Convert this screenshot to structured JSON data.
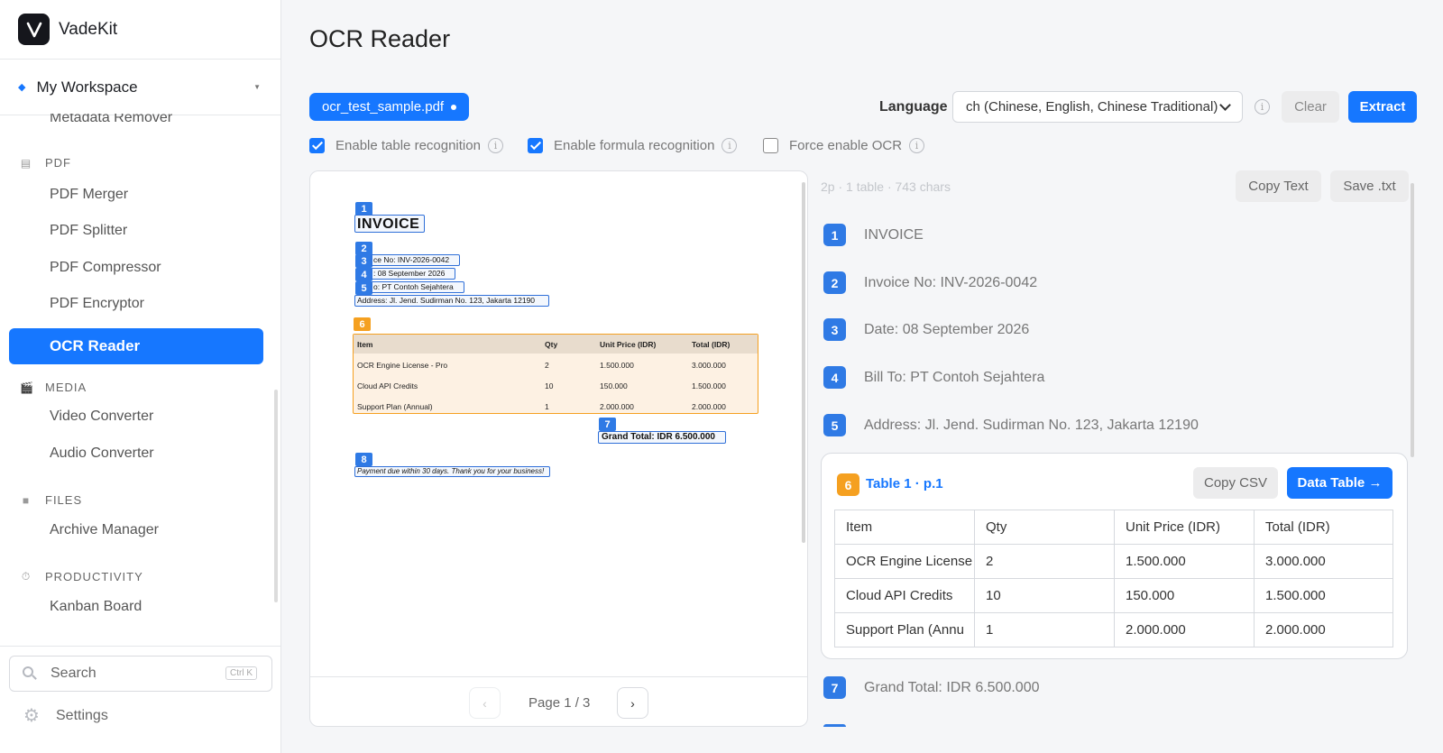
{
  "app": {
    "name": "VadeKit"
  },
  "workspace": {
    "label": "My Workspace"
  },
  "sidebar": {
    "items": {
      "metadata_remover": "Metadata Remover",
      "pdf_section": "PDF",
      "pdf_merger": "PDF Merger",
      "pdf_splitter": "PDF Splitter",
      "pdf_compressor": "PDF Compressor",
      "pdf_encryptor": "PDF Encryptor",
      "ocr_reader": "OCR Reader",
      "media_section": "MEDIA",
      "video_converter": "Video Converter",
      "audio_converter": "Audio Converter",
      "files_section": "FILES",
      "archive_manager": "Archive Manager",
      "productivity_section": "PRODUCTIVITY",
      "kanban_board": "Kanban Board"
    },
    "search": {
      "label": "Search",
      "shortcut": "Ctrl K"
    },
    "settings": "Settings"
  },
  "page": {
    "title": "OCR Reader"
  },
  "toolbar": {
    "file_name": "ocr_test_sample.pdf",
    "language_label": "Language",
    "language_value": "ch (Chinese, English, Chinese Traditional)",
    "clear": "Clear",
    "extract": "Extract"
  },
  "options": {
    "table": {
      "label": "Enable table recognition",
      "checked": true
    },
    "formula": {
      "label": "Enable formula recognition",
      "checked": true
    },
    "force_ocr": {
      "label": "Force enable OCR",
      "checked": false
    }
  },
  "preview": {
    "page_indicator": "Page 1 / 3",
    "tags": [
      "1",
      "2",
      "3",
      "4",
      "5",
      "6",
      "7",
      "8"
    ],
    "doc": {
      "title": "INVOICE",
      "line3": "ce No: INV-2026-0042",
      "line4": ": 08 September 2026",
      "line5": "o: PT Contoh Sejahtera",
      "address": "Address: Jl. Jend. Sudirman No. 123, Jakarta 12190",
      "table_header": [
        "Item",
        "Qty",
        "Unit Price (IDR)",
        "Total (IDR)"
      ],
      "table_rows": [
        [
          "OCR Engine License - Pro",
          "2",
          "1.500.000",
          "3.000.000"
        ],
        [
          "Cloud API Credits",
          "10",
          "150.000",
          "1.500.000"
        ],
        [
          "Support Plan (Annual)",
          "1",
          "2.000.000",
          "2.000.000"
        ]
      ],
      "grand_total": "Grand Total: IDR 6.500.000",
      "footnote": "Payment due within 30 days. Thank you for your business!"
    }
  },
  "results": {
    "meta": "2p · 1 table · 743 chars",
    "copy_text": "Copy Text",
    "save_txt": "Save .txt",
    "items": [
      {
        "num": "1",
        "text": "INVOICE"
      },
      {
        "num": "2",
        "text": "Invoice No: INV-2026-0042"
      },
      {
        "num": "3",
        "text": "Date: 08 September 2026"
      },
      {
        "num": "4",
        "text": "Bill To: PT Contoh Sejahtera"
      },
      {
        "num": "5",
        "text": "Address: Jl. Jend. Sudirman No. 123, Jakarta 12190"
      }
    ],
    "table": {
      "num": "6",
      "title": "Table 1 · p.1",
      "copy_csv": "Copy CSV",
      "data_table": "Data Table →",
      "header": [
        "Item",
        "Qty",
        "Unit Price (IDR)",
        "Total (IDR)"
      ],
      "rows": [
        [
          "OCR Engine License",
          "2",
          "1.500.000",
          "3.000.000"
        ],
        [
          "Cloud API Credits",
          "10",
          "150.000",
          "1.500.000"
        ],
        [
          "Support Plan (Annu",
          "1",
          "2.000.000",
          "2.000.000"
        ]
      ]
    },
    "item7": {
      "num": "7",
      "text": "Grand Total: IDR 6.500.000"
    }
  },
  "colors": {
    "accent": "#1677ff",
    "tag_blue": "#2f7ae5",
    "tag_orange": "#f5a020"
  }
}
